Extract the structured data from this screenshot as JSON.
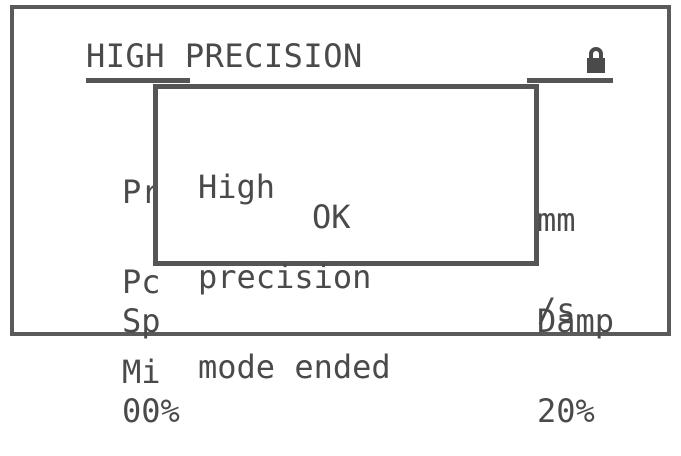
{
  "screen": {
    "title": "HIGH PRECISION",
    "lock_icon": "lock-icon",
    "background_rows_left": [
      "Pr",
      "Pc",
      "Mi"
    ],
    "background_rows_right": [
      "mm",
      "/s"
    ],
    "bottom_left": [
      "Sp",
      "00%"
    ],
    "bottom_right": [
      "Damp",
      "20%"
    ]
  },
  "dialog": {
    "message_lines": [
      "High",
      "precision",
      "mode ended"
    ],
    "ok_label": "OK"
  },
  "colors": {
    "ink": "#4a4a4a",
    "background": "#ffffff",
    "border": "#5a5a5a"
  }
}
